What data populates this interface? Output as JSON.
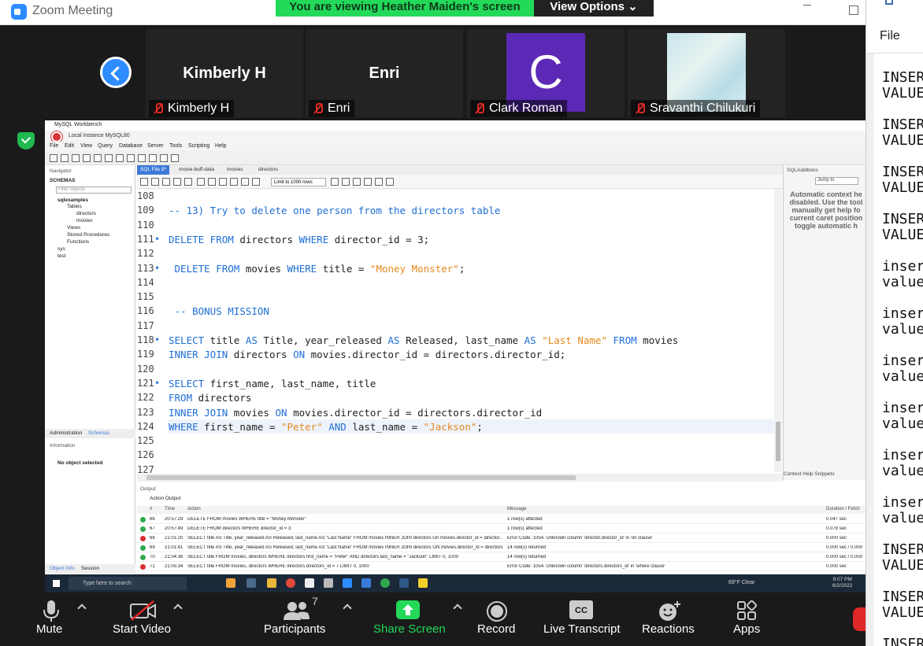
{
  "zoom": {
    "window_title": "Zoom Meeting",
    "banner": "You are viewing Heather Maiden's screen",
    "view_options": "View Options ⌄"
  },
  "participants": [
    {
      "display_big": "Kimberly H",
      "label": "Kimberly H"
    },
    {
      "display_big": "Enri",
      "label": "Enri"
    },
    {
      "avatar_letter": "C",
      "label": "Clark Roman"
    },
    {
      "label": "Sravanthi Chilukuri"
    }
  ],
  "notepad": {
    "menu_file": "File",
    "lines": [
      "INSER",
      "VALUE",
      "INSER",
      "VALUE",
      "INSER",
      "VALUE",
      "INSER",
      "VALUE",
      "inser",
      "value",
      "inser",
      "value",
      "inser",
      "value",
      "inser",
      "value",
      "inser",
      "value",
      "inser",
      "value",
      "INSER",
      "VALUE",
      "INSER",
      "VALUE",
      "INSER"
    ]
  },
  "workbench": {
    "app_title": "MySQL Workbench",
    "instance_tab": "Local instance MySQL80",
    "menu": [
      "File",
      "Edit",
      "View",
      "Query",
      "Database",
      "Server",
      "Tools",
      "Scripting",
      "Help"
    ],
    "navigator": {
      "header": "Navigator",
      "schemas_label": "SCHEMAS",
      "filter_placeholder": "Filter objects",
      "tree": [
        "sqlexamples",
        "Tables",
        "directors",
        "movies",
        "Views",
        "Stored Procedures",
        "Functions",
        "sys",
        "test"
      ],
      "tabs": [
        "Administration",
        "Schemas"
      ],
      "info_header": "Information",
      "no_object": "No object selected",
      "bottom_tabs": [
        "Object Info",
        "Session"
      ]
    },
    "editor_tabs": [
      "SQL File 9*",
      "movie-buff-data",
      "movies",
      "directors"
    ],
    "limit": "Limit to 1000 rows",
    "code_lines": [
      {
        "n": "108",
        "dot": false,
        "html": ""
      },
      {
        "n": "109",
        "dot": false,
        "html": "<span class='cm'>-- 13) Try to delete one person from the directors table</span>"
      },
      {
        "n": "110",
        "dot": false,
        "html": ""
      },
      {
        "n": "111",
        "dot": true,
        "html": "<span class='kw'>DELETE FROM</span> directors <span class='kw'>WHERE</span> director_id = 3;"
      },
      {
        "n": "112",
        "dot": false,
        "html": ""
      },
      {
        "n": "113",
        "dot": true,
        "html": " <span class='kw'>DELETE FROM</span> movies <span class='kw'>WHERE</span> title = <span class='str'>\"Money Monster\"</span>;"
      },
      {
        "n": "114",
        "dot": false,
        "html": ""
      },
      {
        "n": "115",
        "dot": false,
        "html": ""
      },
      {
        "n": "116",
        "dot": false,
        "html": " <span class='cm'>-- BONUS MISSION</span>"
      },
      {
        "n": "117",
        "dot": false,
        "html": ""
      },
      {
        "n": "118",
        "dot": true,
        "html": "<span class='kw'>SELECT</span> title <span class='kw'>AS</span> Title, year_released <span class='kw'>AS</span> Released, last_name <span class='kw'>AS</span> <span class='str'>\"Last Name\"</span> <span class='kw'>FROM</span> movies"
      },
      {
        "n": "119",
        "dot": false,
        "html": "<span class='kw'>INNER JOIN</span> directors <span class='kw'>ON</span> movies.director_id = directors.director_id;"
      },
      {
        "n": "120",
        "dot": false,
        "html": ""
      },
      {
        "n": "121",
        "dot": true,
        "html": "<span class='kw'>SELECT</span> first_name, last_name, title"
      },
      {
        "n": "122",
        "dot": false,
        "html": "<span class='kw'>FROM</span> directors"
      },
      {
        "n": "123",
        "dot": false,
        "html": "<span class='kw'>INNER JOIN</span> movies <span class='kw'>ON</span> movies.director_id = directors.director_id"
      },
      {
        "n": "124",
        "dot": false,
        "html": "<span class='kw'>WHERE</span> first_name = <span class='str'>\"Peter\"</span> <span class='kw'>AND</span> last_name = <span class='str'>\"Jackson\"</span>;"
      },
      {
        "n": "125",
        "dot": false,
        "html": ""
      },
      {
        "n": "126",
        "dot": false,
        "html": ""
      },
      {
        "n": "127",
        "dot": false,
        "html": ""
      }
    ],
    "sql_additions": {
      "header": "SQLAdditions",
      "jump": "Jump to",
      "help_text": "Automatic context he disabled. Use the tool manually get help fo current caret position toggle automatic h",
      "tabs": "Context Help   Snippets"
    },
    "output": {
      "header": "Output",
      "action_select": "Action Output",
      "columns": [
        "#",
        "Time",
        "Action",
        "Message",
        "Duration / Fetch"
      ],
      "rows": [
        {
          "status": "ok",
          "n": "66",
          "time": "20:57:29",
          "action": "DELETE FROM movies WHERE title = \"Money Monster\"",
          "message": "1 row(s) affected",
          "duration": "0.047 sec"
        },
        {
          "status": "ok",
          "n": "67",
          "time": "20:57:49",
          "action": "DELETE FROM directors WHERE director_id = 3",
          "message": "1 row(s) affected",
          "duration": "0.078 sec"
        },
        {
          "status": "err",
          "n": "68",
          "time": "21:01:20",
          "action": "SELECT title AS Title, year_released AS Released, last_name AS \"Last Name\"  FROM movies  INNER JOIN directors On movies.director_id = director...",
          "message": "Error Code: 1054. Unknown column 'director.director_id' in 'on clause'",
          "duration": "0.000 sec"
        },
        {
          "status": "ok",
          "n": "69",
          "time": "21:01:41",
          "action": "SELECT title AS Title, year_released AS Released, last_name AS \"Last Name\" FROM movies INNER JOIN directors ON movies.director_id = directors...",
          "message": "14 row(s) returned",
          "duration": "0.000 sec / 0.000"
        },
        {
          "status": "ok",
          "n": "70",
          "time": "21:04:36",
          "action": "SELECT title  FROM movies, directors WHERE directors.first_name = \"Peter\" AND directors.last_name = \"Jackson\" LIMIT 0, 1000",
          "message": "14 row(s) returned",
          "duration": "0.000 sec / 0.000"
        },
        {
          "status": "err",
          "n": "71",
          "time": "21:05:34",
          "action": "SELECT title  FROM movies, directors WHERE directors.directors_id = 7 LIMIT 0, 1000",
          "message": "Error Code: 1054. Unknown column 'directors.directors_id' in 'where clause'",
          "duration": "0.000 sec"
        }
      ]
    },
    "taskbar": {
      "search_placeholder": "Type here to search",
      "weather": "69°F  Clear",
      "time": "9:07 PM",
      "date": "6/2/2022"
    }
  },
  "toolbar": {
    "mute": "Mute",
    "start_video": "Start Video",
    "participants": "Participants",
    "participant_count": "7",
    "share_screen": "Share Screen",
    "record": "Record",
    "live_transcript": "Live Transcript",
    "reactions": "Reactions",
    "apps": "Apps"
  },
  "colors": {
    "zoom_green": "#23d959",
    "zoom_blue": "#2d8cff",
    "sql_keyword": "#1f6fd6",
    "sql_string": "#e58a1e"
  }
}
